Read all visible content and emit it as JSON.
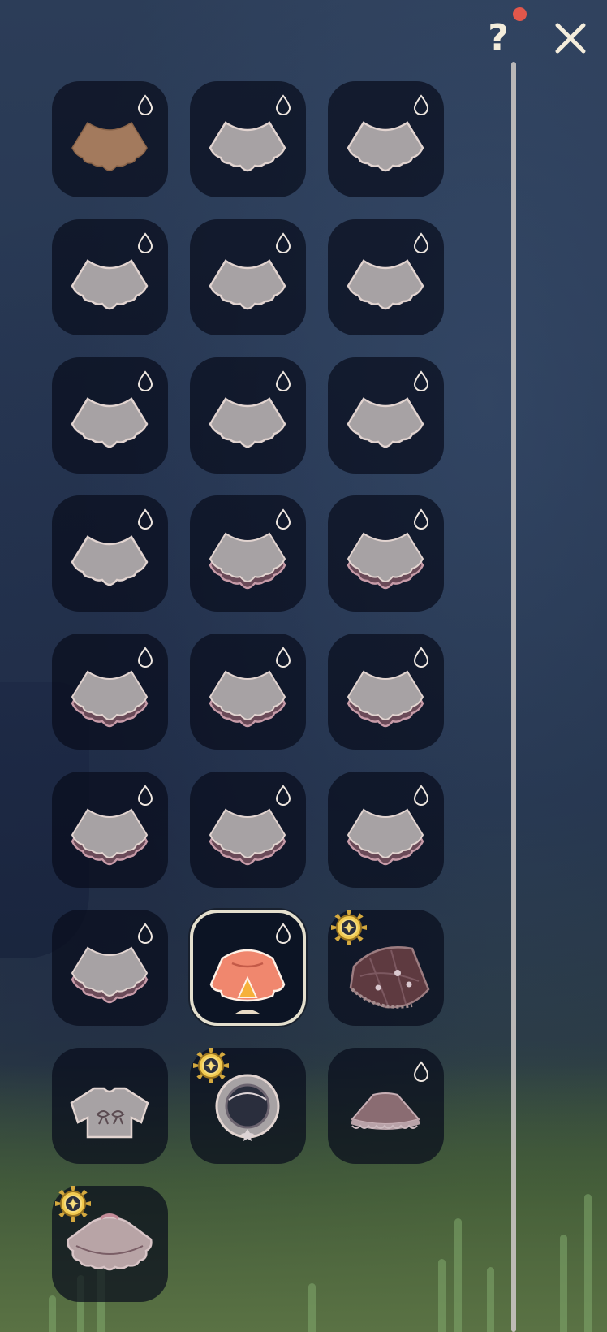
{
  "header": {
    "help_label": "?",
    "notification": true
  },
  "items": [
    {
      "name": "cape-1",
      "style": "tan",
      "drop": true,
      "badge": false,
      "selected": false
    },
    {
      "name": "cape-2",
      "style": "plain",
      "drop": true,
      "badge": false,
      "selected": false
    },
    {
      "name": "cape-3",
      "style": "plain",
      "drop": true,
      "badge": false,
      "selected": false
    },
    {
      "name": "cape-4",
      "style": "plain",
      "drop": true,
      "badge": false,
      "selected": false
    },
    {
      "name": "cape-5",
      "style": "plain",
      "drop": true,
      "badge": false,
      "selected": false
    },
    {
      "name": "cape-6",
      "style": "plain",
      "drop": true,
      "badge": false,
      "selected": false
    },
    {
      "name": "cape-7",
      "style": "plain",
      "drop": true,
      "badge": false,
      "selected": false
    },
    {
      "name": "cape-8",
      "style": "plain",
      "drop": true,
      "badge": false,
      "selected": false
    },
    {
      "name": "cape-9",
      "style": "plain",
      "drop": true,
      "badge": false,
      "selected": false
    },
    {
      "name": "cape-10",
      "style": "plain",
      "drop": true,
      "badge": false,
      "selected": false
    },
    {
      "name": "cape-11",
      "style": "trim",
      "drop": true,
      "badge": false,
      "selected": false
    },
    {
      "name": "cape-12",
      "style": "trim",
      "drop": true,
      "badge": false,
      "selected": false
    },
    {
      "name": "cape-13",
      "style": "trim",
      "drop": true,
      "badge": false,
      "selected": false
    },
    {
      "name": "cape-14",
      "style": "trim",
      "drop": true,
      "badge": false,
      "selected": false
    },
    {
      "name": "cape-15",
      "style": "trim",
      "drop": true,
      "badge": false,
      "selected": false
    },
    {
      "name": "cape-16",
      "style": "trim",
      "drop": true,
      "badge": false,
      "selected": false
    },
    {
      "name": "cape-17",
      "style": "trim",
      "drop": true,
      "badge": false,
      "selected": false
    },
    {
      "name": "cape-18",
      "style": "trim",
      "drop": true,
      "badge": false,
      "selected": false
    },
    {
      "name": "cape-19",
      "style": "trim",
      "drop": true,
      "badge": false,
      "selected": false
    },
    {
      "name": "cape-20",
      "style": "orange",
      "drop": true,
      "badge": false,
      "selected": true
    },
    {
      "name": "cape-21",
      "style": "quilt",
      "drop": false,
      "badge": true,
      "selected": false
    },
    {
      "name": "cape-22",
      "style": "shirt",
      "drop": false,
      "badge": false,
      "selected": false
    },
    {
      "name": "cape-23",
      "style": "ring",
      "drop": false,
      "badge": true,
      "selected": false
    },
    {
      "name": "cape-24",
      "style": "skirt",
      "drop": true,
      "badge": false,
      "selected": false
    },
    {
      "name": "cape-25",
      "style": "frill",
      "drop": false,
      "badge": true,
      "selected": false
    }
  ],
  "colors": {
    "cape_fill": "#a7a2a4",
    "cape_outline": "#e2d4d0",
    "cape_trim": "#c79ba8",
    "tan": "#a37a5d",
    "orange": "#f0876e",
    "accent_red": "#e2574b",
    "gold": "#d4a93f"
  }
}
